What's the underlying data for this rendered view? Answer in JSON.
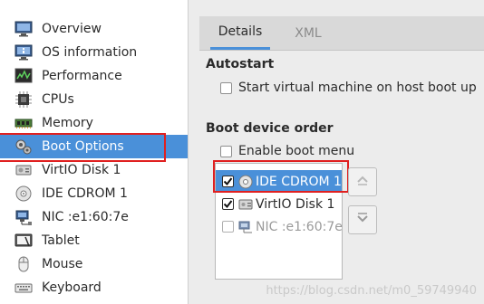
{
  "sidebar": {
    "items": [
      {
        "label": "Overview",
        "icon": "monitor-icon"
      },
      {
        "label": "OS information",
        "icon": "monitor-info-icon"
      },
      {
        "label": "Performance",
        "icon": "performance-graph-icon"
      },
      {
        "label": "CPUs",
        "icon": "cpu-chip-icon"
      },
      {
        "label": "Memory",
        "icon": "memory-module-icon"
      },
      {
        "label": "Boot Options",
        "icon": "gears-icon"
      },
      {
        "label": "VirtIO Disk 1",
        "icon": "hard-disk-icon"
      },
      {
        "label": "IDE CDROM 1",
        "icon": "cdrom-disc-icon"
      },
      {
        "label": "NIC :e1:60:7e",
        "icon": "network-card-icon"
      },
      {
        "label": "Tablet",
        "icon": "tablet-icon"
      },
      {
        "label": "Mouse",
        "icon": "mouse-icon"
      },
      {
        "label": "Keyboard",
        "icon": "keyboard-icon"
      }
    ],
    "selected": "Boot Options"
  },
  "tabs": {
    "details": "Details",
    "xml": "XML",
    "active": "Details"
  },
  "autostart": {
    "title": "Autostart",
    "checkbox_label": "Start virtual machine on host boot up",
    "checked": false
  },
  "boot": {
    "title": "Boot device order",
    "enable_menu_label": "Enable boot menu",
    "enable_menu_checked": false,
    "devices": [
      {
        "label": "IDE CDROM 1",
        "checked": true,
        "selected": true,
        "enabled": true,
        "icon": "cdrom-disc-icon"
      },
      {
        "label": "VirtIO Disk 1",
        "checked": true,
        "selected": false,
        "enabled": true,
        "icon": "hard-disk-icon"
      },
      {
        "label": "NIC :e1:60:7e",
        "checked": false,
        "selected": false,
        "enabled": false,
        "icon": "network-card-icon"
      }
    ],
    "move_up_icon": "arrow-up-icon",
    "move_down_icon": "arrow-down-icon"
  },
  "colors": {
    "selection": "#4a90d9",
    "annotation_red": "#e02020"
  },
  "watermark": "https://blog.csdn.net/m0_59749940"
}
